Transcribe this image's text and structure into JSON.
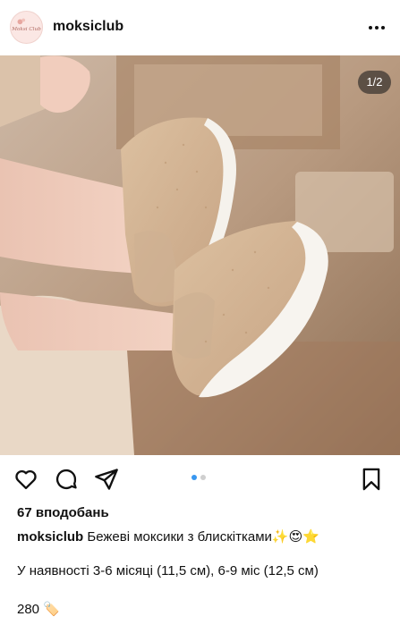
{
  "header": {
    "username": "moksiclub",
    "avatar_text": "Moksi Club",
    "more_icon": "more-dots-icon"
  },
  "photo": {
    "counter": "1/2",
    "description_icon": "baby-shoes-photo"
  },
  "actions": {
    "like_icon": "heart-icon",
    "comment_icon": "comment-icon",
    "share_icon": "send-icon",
    "save_icon": "bookmark-icon",
    "carousel_active_index": 0,
    "carousel_count": 2,
    "accent": "#3897f0"
  },
  "post": {
    "likes": "67 вподобань",
    "caption_user": "moksiclub",
    "caption_text": "Бежеві моксики з блискітками",
    "caption_emojis": "✨😍⭐",
    "availability": "У наявності 3-6 місяці (11,5 см), 6-9 міс (12,5 см)",
    "price": "280",
    "price_emoji": "🏷️"
  }
}
